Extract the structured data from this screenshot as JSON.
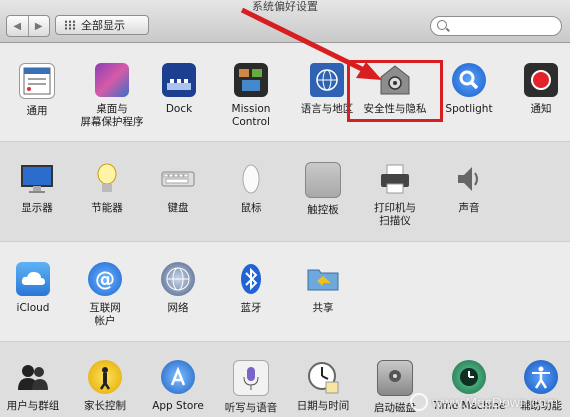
{
  "window": {
    "title": "系统偏好设置"
  },
  "toolbar": {
    "back": "◀",
    "forward": "▶",
    "show_all": "全部显示",
    "search_placeholder": ""
  },
  "rows": [
    [
      {
        "label": "通用",
        "icon": "general-icon"
      },
      {
        "label": "桌面与\n屏幕保护程序",
        "icon": "desktop-icon"
      },
      {
        "label": "Dock",
        "icon": "dock-icon"
      },
      {
        "label": "Mission\nControl",
        "icon": "mission-control-icon"
      },
      {
        "label": "语言与地区",
        "icon": "language-icon"
      },
      {
        "label": "安全性与隐私",
        "icon": "security-icon"
      },
      {
        "label": "Spotlight",
        "icon": "spotlight-icon"
      },
      {
        "label": "通知",
        "icon": "notifications-icon"
      }
    ],
    [
      {
        "label": "显示器",
        "icon": "displays-icon"
      },
      {
        "label": "节能器",
        "icon": "energy-icon"
      },
      {
        "label": "键盘",
        "icon": "keyboard-icon"
      },
      {
        "label": "鼠标",
        "icon": "mouse-icon"
      },
      {
        "label": "触控板",
        "icon": "trackpad-icon"
      },
      {
        "label": "打印机与\n扫描仪",
        "icon": "printer-icon"
      },
      {
        "label": "声音",
        "icon": "sound-icon"
      }
    ],
    [
      {
        "label": "iCloud",
        "icon": "icloud-icon"
      },
      {
        "label": "互联网\n帐户",
        "icon": "internet-accounts-icon"
      },
      {
        "label": "网络",
        "icon": "network-icon"
      },
      {
        "label": "蓝牙",
        "icon": "bluetooth-icon"
      },
      {
        "label": "共享",
        "icon": "sharing-icon"
      }
    ],
    [
      {
        "label": "用户与群组",
        "icon": "users-icon"
      },
      {
        "label": "家长控制",
        "icon": "parental-icon"
      },
      {
        "label": "App Store",
        "icon": "appstore-icon"
      },
      {
        "label": "听写与语音",
        "icon": "dictation-icon"
      },
      {
        "label": "日期与时间",
        "icon": "datetime-icon"
      },
      {
        "label": "启动磁盘",
        "icon": "startup-disk-icon"
      },
      {
        "label": "Time Machine",
        "icon": "timemachine-icon"
      },
      {
        "label": "辅助功能",
        "icon": "accessibility-icon"
      }
    ]
  ],
  "watermark": "www.MacDown.com"
}
